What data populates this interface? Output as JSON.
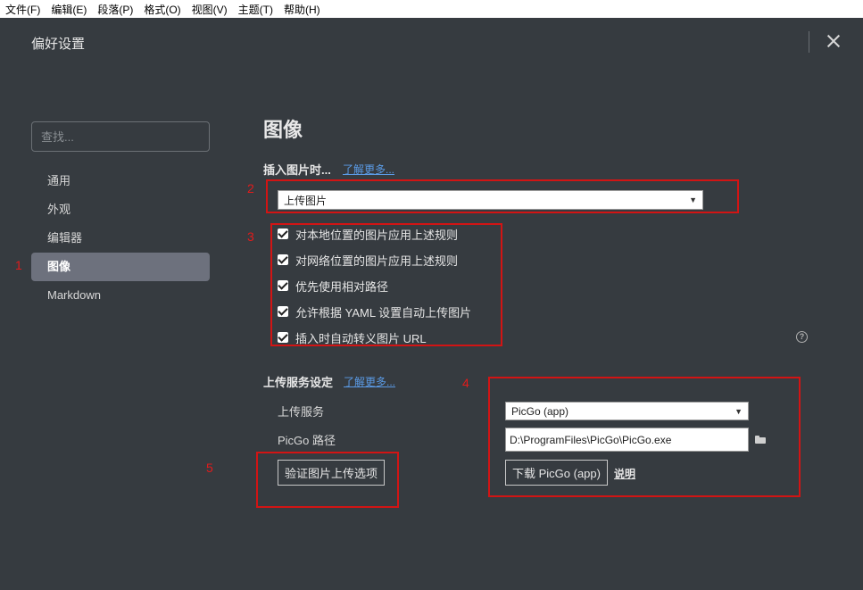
{
  "menubar": {
    "items": [
      "文件(F)",
      "编辑(E)",
      "段落(P)",
      "格式(O)",
      "视图(V)",
      "主题(T)",
      "帮助(H)"
    ]
  },
  "dialog": {
    "title": "偏好设置"
  },
  "sidebar": {
    "search_placeholder": "查找...",
    "items": [
      {
        "label": "通用"
      },
      {
        "label": "外观"
      },
      {
        "label": "编辑器"
      },
      {
        "label": "图像",
        "active": true
      },
      {
        "label": "Markdown"
      }
    ]
  },
  "annotations": {
    "n1": "1",
    "n2": "2",
    "n3": "3",
    "n4": "4",
    "n5": "5"
  },
  "image_section": {
    "title": "图像",
    "insert_label": "插入图片时...",
    "insert_learn_more": "了解更多...",
    "insert_action_value": "上传图片",
    "checkboxes": [
      {
        "label": "对本地位置的图片应用上述规则",
        "checked": true
      },
      {
        "label": "对网络位置的图片应用上述规则",
        "checked": true
      },
      {
        "label": "优先使用相对路径",
        "checked": true
      },
      {
        "label": "允许根据 YAML 设置自动上传图片",
        "checked": true
      },
      {
        "label": "插入时自动转义图片 URL",
        "checked": true
      }
    ],
    "help_icon": "?"
  },
  "upload_section": {
    "title": "上传服务设定",
    "learn_more": "了解更多...",
    "service_label": "上传服务",
    "service_value": "PicGo (app)",
    "path_label": "PicGo 路径",
    "path_value": "D:\\ProgramFiles\\PicGo\\PicGo.exe",
    "download_button": "下载 PicGo (app)",
    "help_link": "说明",
    "verify_button": "验证图片上传选项"
  },
  "colors": {
    "background": "#363b40",
    "sidebar_active": "#6d717d",
    "link": "#5b9be6",
    "annotation_red": "#d21414"
  },
  "icons": {
    "close": "close-icon",
    "dropdown": "chevron-down-icon",
    "checkbox": "checkmark-icon",
    "help": "question-circle-icon",
    "folder": "folder-icon"
  }
}
